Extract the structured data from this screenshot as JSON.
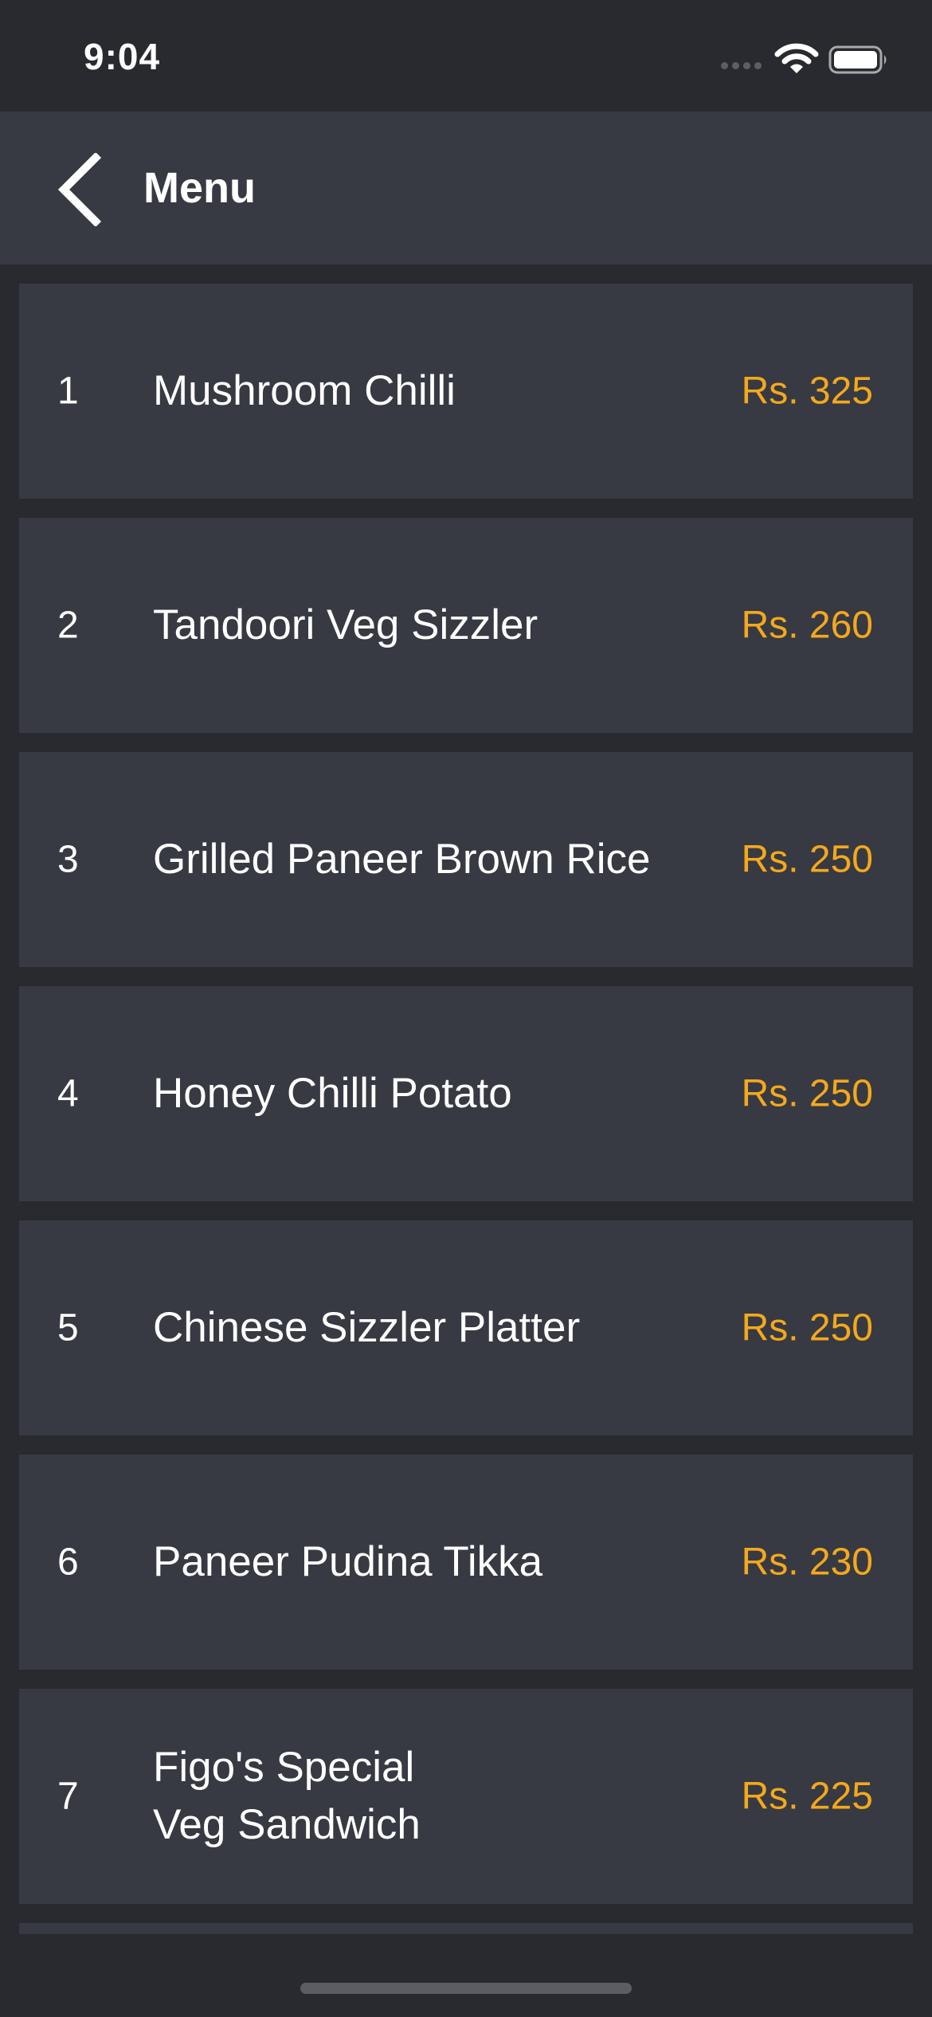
{
  "status_bar": {
    "time": "9:04"
  },
  "nav": {
    "title": "Menu",
    "back_icon": "chevron-left-icon"
  },
  "colors": {
    "background": "#282a2f",
    "card": "#373a42",
    "price_accent": "#f4a81d",
    "text": "#ffffff"
  },
  "menu": {
    "items": [
      {
        "number": "1",
        "name": "Mushroom Chilli",
        "price": "Rs. 325"
      },
      {
        "number": "2",
        "name": "Tandoori Veg Sizzler",
        "price": "Rs. 260"
      },
      {
        "number": "3",
        "name": "Grilled Paneer Brown Rice",
        "price": "Rs. 250"
      },
      {
        "number": "4",
        "name": "Honey Chilli Potato",
        "price": "Rs. 250"
      },
      {
        "number": "5",
        "name": "Chinese Sizzler Platter",
        "price": "Rs. 250"
      },
      {
        "number": "6",
        "name": "Paneer Pudina Tikka",
        "price": "Rs. 230"
      },
      {
        "number": "7",
        "name": "Figo's Special\nVeg Sandwich",
        "price": "Rs. 225"
      }
    ]
  }
}
